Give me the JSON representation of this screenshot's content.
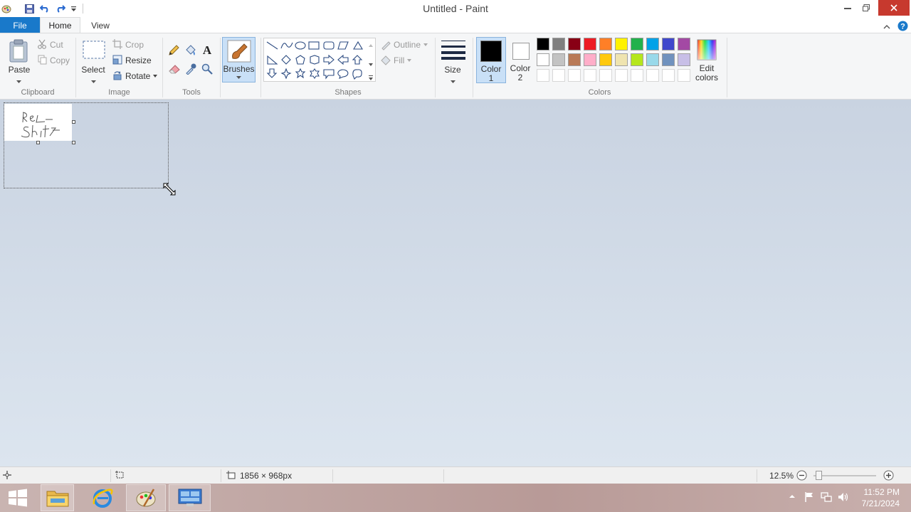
{
  "window": {
    "title": "Untitled - Paint"
  },
  "tabs": {
    "file": "File",
    "home": "Home",
    "view": "View"
  },
  "clipboard": {
    "paste": "Paste",
    "cut": "Cut",
    "copy": "Copy",
    "group": "Clipboard"
  },
  "image": {
    "select": "Select",
    "crop": "Crop",
    "resize": "Resize",
    "rotate": "Rotate",
    "group": "Image"
  },
  "tools": {
    "group": "Tools"
  },
  "brushes": {
    "label": "Brushes"
  },
  "shapes": {
    "outline": "Outline",
    "fill": "Fill",
    "group": "Shapes"
  },
  "size": {
    "label": "Size"
  },
  "colors": {
    "color1_line1": "Color",
    "color1_line2": "1",
    "color2_line1": "Color",
    "color2_line2": "2",
    "edit_line1": "Edit",
    "edit_line2": "colors",
    "group": "Colors",
    "color1": "#000000",
    "color2": "#ffffff",
    "palette_row1": [
      "#000000",
      "#7f7f7f",
      "#880015",
      "#ed1c24",
      "#ff7f27",
      "#fff200",
      "#22b14c",
      "#00a2e8",
      "#3f48cc",
      "#a349a4"
    ],
    "palette_row2": [
      "#ffffff",
      "#c3c3c3",
      "#b97a57",
      "#ffaec9",
      "#ffc90e",
      "#efe4b0",
      "#b5e61d",
      "#99d9ea",
      "#7092be",
      "#c8bfe7"
    ]
  },
  "canvas": {
    "text_line1": "Real",
    "text_line2": "Shity"
  },
  "status": {
    "dimensions": "1856 × 968px",
    "zoom": "12.5%"
  },
  "taskbar": {
    "time": "11:52 PM",
    "date": "7/21/2024"
  }
}
